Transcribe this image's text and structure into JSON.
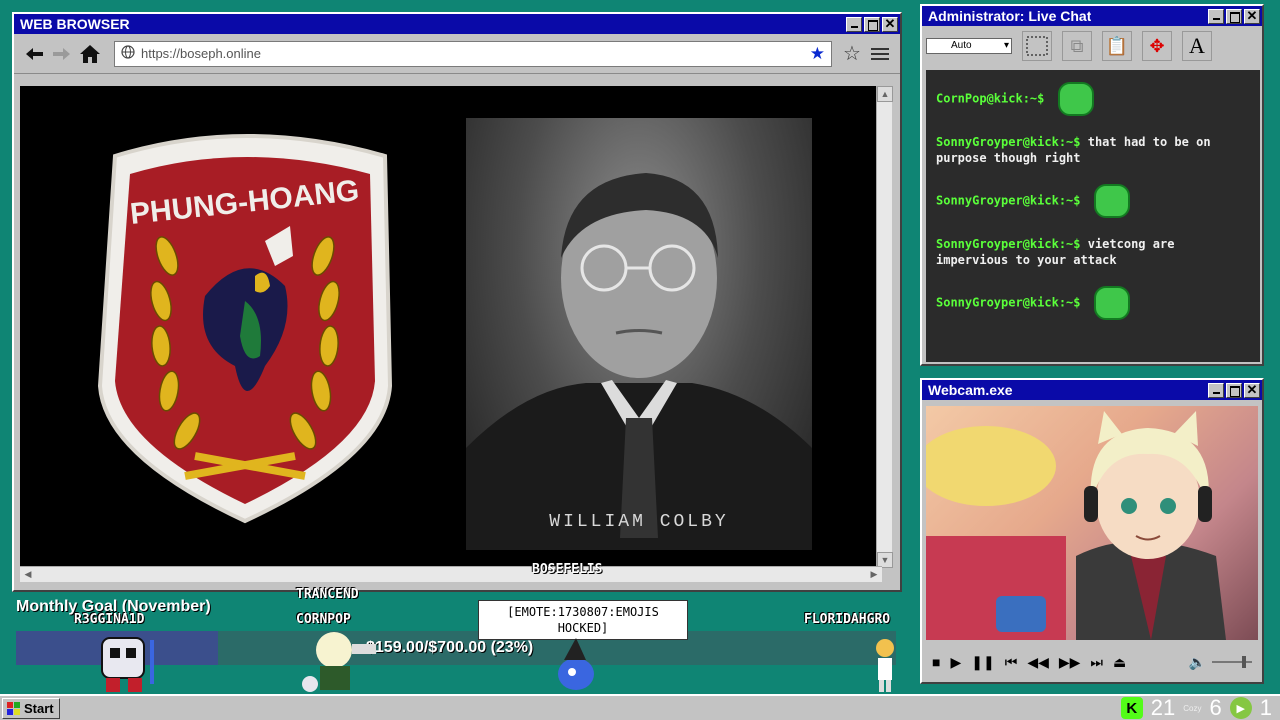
{
  "browser": {
    "title": "WEB BROWSER",
    "url": "https://boseph.online",
    "video_caption": "WILLIAM COLBY",
    "patch_text": "PHUNG-HOANG"
  },
  "chat": {
    "title": "Administrator: Live Chat",
    "font_select": "Auto",
    "messages": [
      {
        "user": "CornPop@kick:~$",
        "text": ""
      },
      {
        "user": "SonnyGroyper@kick:~$",
        "text": "that had to be on purpose though right"
      },
      {
        "user": "SonnyGroyper@kick:~$",
        "text": ""
      },
      {
        "user": "SonnyGroyper@kick:~$",
        "text": "vietcong are impervious to your attack"
      },
      {
        "user": "SonnyGroyper@kick:~$",
        "text": ""
      }
    ]
  },
  "webcam": {
    "title": "Webcam.exe"
  },
  "overlay": {
    "goal_title": "Monthly Goal (November)",
    "goal_text": "$159.00/$700.00 (23%)",
    "goal_fraction": 0.23,
    "names": [
      "R3GGINA1D",
      "TRANCEND",
      "CORNPOP",
      "BOSEFELIS",
      "FLORIDAHGRO"
    ],
    "bubble": "[EMOTE:1730807:EMOJIS HOCKED]"
  },
  "taskbar": {
    "start_label": "Start",
    "kick_count": "21",
    "cozy_label": "Cozy",
    "cozy_count": "6",
    "rumble_count": "1"
  },
  "colors": {
    "desktop": "#0f8574",
    "titlebar": "#0a0aa8",
    "chat_user": "#5aff3a",
    "kick_green": "#53fc18"
  }
}
